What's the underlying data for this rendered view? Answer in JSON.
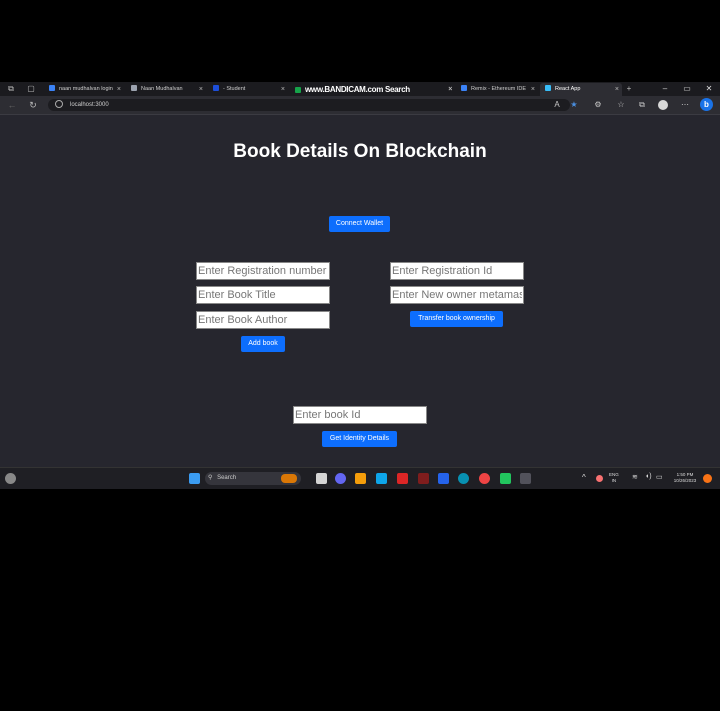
{
  "browser": {
    "tabs": [
      {
        "label": "naan mudhalvan login",
        "active": false,
        "favicon": "#3b82f6"
      },
      {
        "label": "Naan Mudhalvan",
        "active": false,
        "favicon": "#9ca3af"
      },
      {
        "label": "- Student",
        "active": false,
        "favicon": "#1d4ed8"
      },
      {
        "label": "www.BANDICAM.com Search",
        "active": false,
        "favicon": "#16a34a"
      },
      {
        "label": "Remix - Ethereum IDE",
        "active": false,
        "favicon": "#3b82f6"
      },
      {
        "label": "React App",
        "active": true,
        "favicon": "#38bdf8"
      }
    ],
    "new_tab": "+",
    "url": "localhost:3000"
  },
  "app": {
    "title": "Book Details On Blockchain",
    "connect_button": "Connect Wallet",
    "add_book": {
      "registration_placeholder": "Enter Registration number",
      "title_placeholder": "Enter Book Title",
      "author_placeholder": "Enter Book Author",
      "button": "Add book"
    },
    "transfer": {
      "registration_placeholder": "Enter Registration Id",
      "owner_placeholder": "Enter New owner metamask address",
      "button": "Transfer book ownership"
    },
    "identity": {
      "book_id_placeholder": "Enter book Id",
      "button": "Get Identity Details"
    }
  },
  "taskbar": {
    "search": "Search",
    "lang_1": "ENG",
    "lang_2": "IN",
    "time": "1:50 PM",
    "date": "10/26/2023"
  },
  "colors": {
    "page_background": "#26262e",
    "primary_button": "#0d6efd",
    "browser_chrome": "#1b1b1f",
    "outer_background": "#000000"
  }
}
